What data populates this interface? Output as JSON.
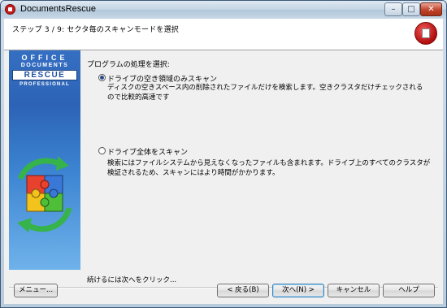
{
  "window": {
    "title": "DocumentsRescue"
  },
  "titlebar_buttons": {
    "minimize": "–",
    "maximize": "□",
    "close": "✕"
  },
  "header": {
    "step_title": "ステップ 3 / 9: セクタ毎のスキャンモードを選択"
  },
  "sidebar": {
    "brand_line1": "OFFICE",
    "brand_line2": "DOCUMENTS",
    "brand_line3": "RESCUE",
    "brand_line4": "PROFESSIONAL"
  },
  "content": {
    "prompt": "プログラムの処理を選択:",
    "options": [
      {
        "label": "ドライブの空き領域のみスキャン",
        "description": "ディスクの空きスペース内の削除されたファイルだけを検索します。空きクラスタだけチェックされるので比較的高速です",
        "selected": true
      },
      {
        "label": "ドライブ全体をスキャン",
        "description": "検索にはファイルシステムから見えなくなったファイルも含まれます。ドライブ上のすべてのクラスタが検証されるため、スキャンにはより時間がかかります。",
        "selected": false
      }
    ],
    "continue_hint": "続けるには次へをクリック..."
  },
  "buttons": {
    "menu": "メニュー...",
    "back": "< 戻る(B)",
    "next": "次へ(N) >",
    "cancel": "キャンセル",
    "help": "ヘルプ"
  },
  "colors": {
    "accent": "#2c63b6",
    "logo_red": "#c61a1a"
  }
}
